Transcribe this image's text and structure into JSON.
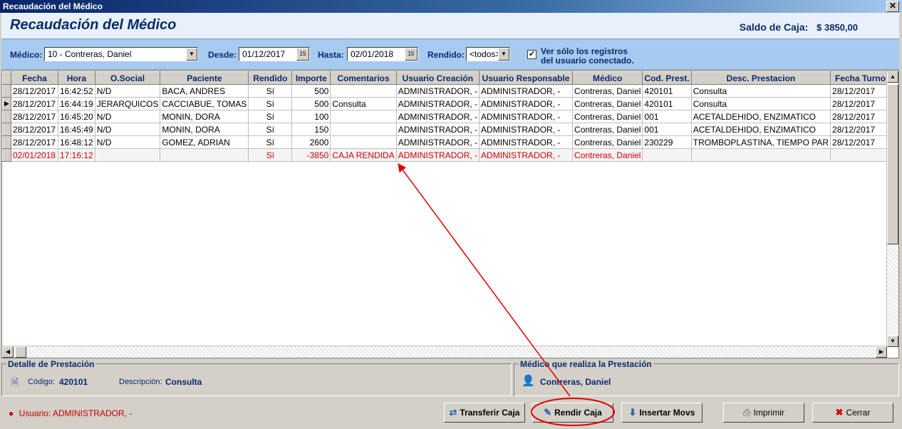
{
  "window": {
    "title": "Recaudación del Médico",
    "close_glyph": "✕"
  },
  "header": {
    "title": "Recaudación del Médico",
    "saldo_label": "Saldo de Caja:",
    "saldo_value": "$ 3850,00"
  },
  "filters": {
    "medico_label": "Médico:",
    "medico_value": "10 - Contreras, Daniel",
    "desde_label": "Desde:",
    "desde_value": "01/12/2017",
    "hasta_label": "Hasta:",
    "hasta_value": "02/01/2018",
    "rendido_label": "Rendido:",
    "rendido_value": "<todos>",
    "check_label": "Ver sólo los registros",
    "check_label_2": "del usuario conectado.",
    "check_mark": "✓",
    "calendar_glyph": "15",
    "dropdown_glyph": "▼"
  },
  "grid": {
    "columns": [
      "Fecha",
      "Hora",
      "O.Social",
      "Paciente",
      "Rendido",
      "Importe",
      "Comentarios",
      "Usuario Creación",
      "Usuario Responsable",
      "Médico",
      "Cod. Prest.",
      "Desc. Prestacion",
      "Fecha Turno"
    ],
    "rows": [
      [
        "28/12/2017",
        "16:42:52",
        "N/D",
        "BACA, ANDRES",
        "Sí",
        "500",
        "",
        "ADMINISTRADOR, -",
        "ADMINISTRADOR, -",
        "Contreras, Daniel",
        "420101",
        "Consulta",
        "28/12/2017"
      ],
      [
        "28/12/2017",
        "16:44:19",
        "JERARQUICOS",
        "CACCIABUE, TOMAS",
        "Sí",
        "500",
        "Consulta",
        "ADMINISTRADOR, -",
        "ADMINISTRADOR, -",
        "Contreras, Daniel",
        "420101",
        "Consulta",
        "28/12/2017"
      ],
      [
        "28/12/2017",
        "16:45:20",
        "N/D",
        "MONIN, DORA",
        "Sí",
        "100",
        "",
        "ADMINISTRADOR, -",
        "ADMINISTRADOR, -",
        "Contreras, Daniel",
        "001",
        "ACETALDEHIDO, ENZIMATICO",
        "28/12/2017"
      ],
      [
        "28/12/2017",
        "16:45:49",
        "N/D",
        "MONIN, DORA",
        "Sí",
        "150",
        "",
        "ADMINISTRADOR, -",
        "ADMINISTRADOR, -",
        "Contreras, Daniel",
        "001",
        "ACETALDEHIDO, ENZIMATICO",
        "28/12/2017"
      ],
      [
        "28/12/2017",
        "16:48:12",
        "N/D",
        "GOMEZ, ADRIAN",
        "Sí",
        "2600",
        "",
        "ADMINISTRADOR, -",
        "ADMINISTRADOR, -",
        "Contreras, Daniel",
        "230229",
        "TROMBOPLASTINA, TIEMPO PAR",
        "28/12/2017"
      ],
      [
        "02/01/2018",
        "17:16:12",
        "",
        "",
        "Sí",
        "-3850",
        "CAJA RENDIDA",
        "ADMINISTRADOR, -",
        "ADMINISTRADOR, -",
        "Contreras, Daniel",
        "",
        "",
        ""
      ]
    ],
    "current_row_marker": "▶",
    "highlight_color": "#d00000"
  },
  "detalle": {
    "title": "Detalle de Prestación",
    "codigo_label": "Código:",
    "codigo_value": "420101",
    "desc_label": "Descripción:",
    "desc_value": "Consulta",
    "icon": "document-icon"
  },
  "medico_panel": {
    "title": "Médico que realiza la Prestación",
    "value": "Contreras, Daniel",
    "icon": "person-icon"
  },
  "footer": {
    "user_label": "Usuario: ADMINISTRADOR, -",
    "buttons": {
      "transferir": "Transferir Caja",
      "rendir": "Rendir Caja",
      "insertar": "Insertar Movs",
      "imprimir": "Imprimir",
      "cerrar": "Cerrar"
    }
  },
  "annotation_color": "#e00000"
}
